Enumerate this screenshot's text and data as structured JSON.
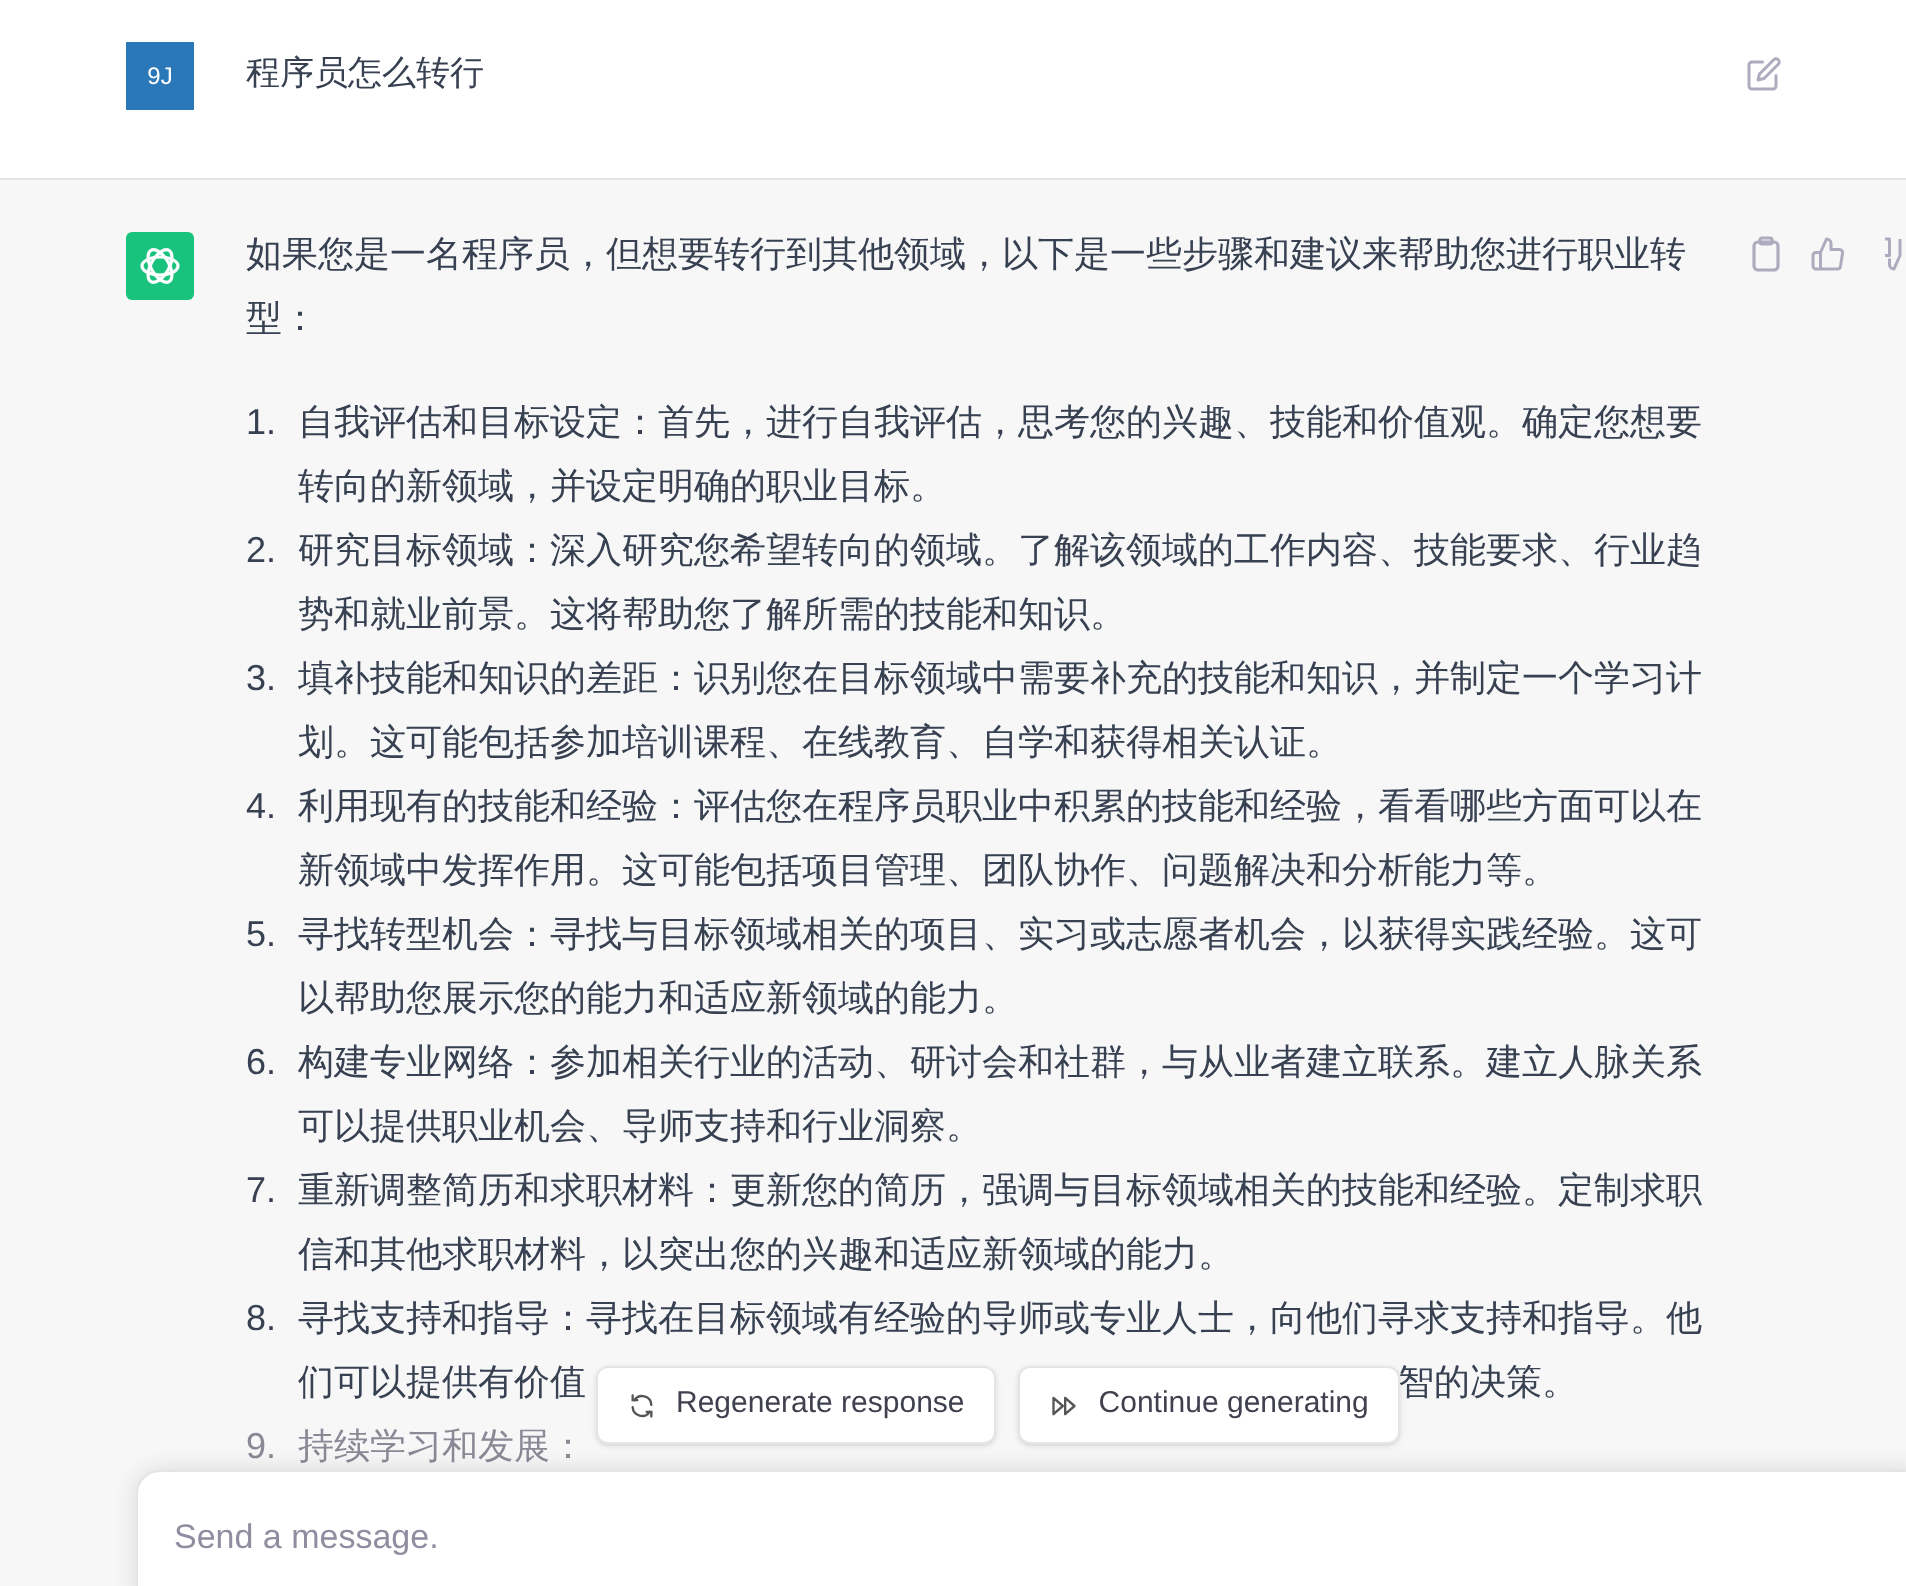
{
  "user_message": {
    "avatar": "9J",
    "text": "程序员怎么转行"
  },
  "assistant_message": {
    "intro": "如果您是一名程序员，但想要转行到其他领域，以下是一些步骤和建议来帮助您进行职业转型：",
    "steps": [
      {
        "number": "1.",
        "text": "自我评估和目标设定：首先，进行自我评估，思考您的兴趣、技能和价值观。确定您想要转向的新领域，并设定明确的职业目标。",
        "faded": false
      },
      {
        "number": "2.",
        "text": "研究目标领域：深入研究您希望转向的领域。了解该领域的工作内容、技能要求、行业趋势和就业前景。这将帮助您了解所需的技能和知识。",
        "faded": false
      },
      {
        "number": "3.",
        "text": "填补技能和知识的差距：识别您在目标领域中需要补充的技能和知识，并制定一个学习计划。这可能包括参加培训课程、在线教育、自学和获得相关认证。",
        "faded": false
      },
      {
        "number": "4.",
        "text": "利用现有的技能和经验：评估您在程序员职业中积累的技能和经验，看看哪些方面可以在新领域中发挥作用。这可能包括项目管理、团队协作、问题解决和分析能力等。",
        "faded": false
      },
      {
        "number": "5.",
        "text": "寻找转型机会：寻找与目标领域相关的项目、实习或志愿者机会，以获得实践经验。这可以帮助您展示您的能力和适应新领域的能力。",
        "faded": false
      },
      {
        "number": "6.",
        "text": "构建专业网络：参加相关行业的活动、研讨会和社群，与从业者建立联系。建立人脉关系可以提供职业机会、导师支持和行业洞察。",
        "faded": false
      },
      {
        "number": "7.",
        "text": "重新调整简历和求职材料：更新您的简历，强调与目标领域相关的技能和经验。定制求职信和其他求职材料，以突出您的兴趣和适应新领域的能力。",
        "faded": false
      },
      {
        "number": "8.",
        "lines": [
          "寻找支持和指导：寻找在目标领域有经验的导师或专业人士，向他们寻求支持和指导。他",
          "们可以提供有价值"
        ],
        "tail": "智的决策。",
        "faded": false
      },
      {
        "number": "9.",
        "text": "持续学习和发展：",
        "faded": true
      }
    ]
  },
  "actions": [
    "Regenerate response",
    "Continue generating"
  ],
  "composer": {
    "placeholder": "Send a message."
  }
}
